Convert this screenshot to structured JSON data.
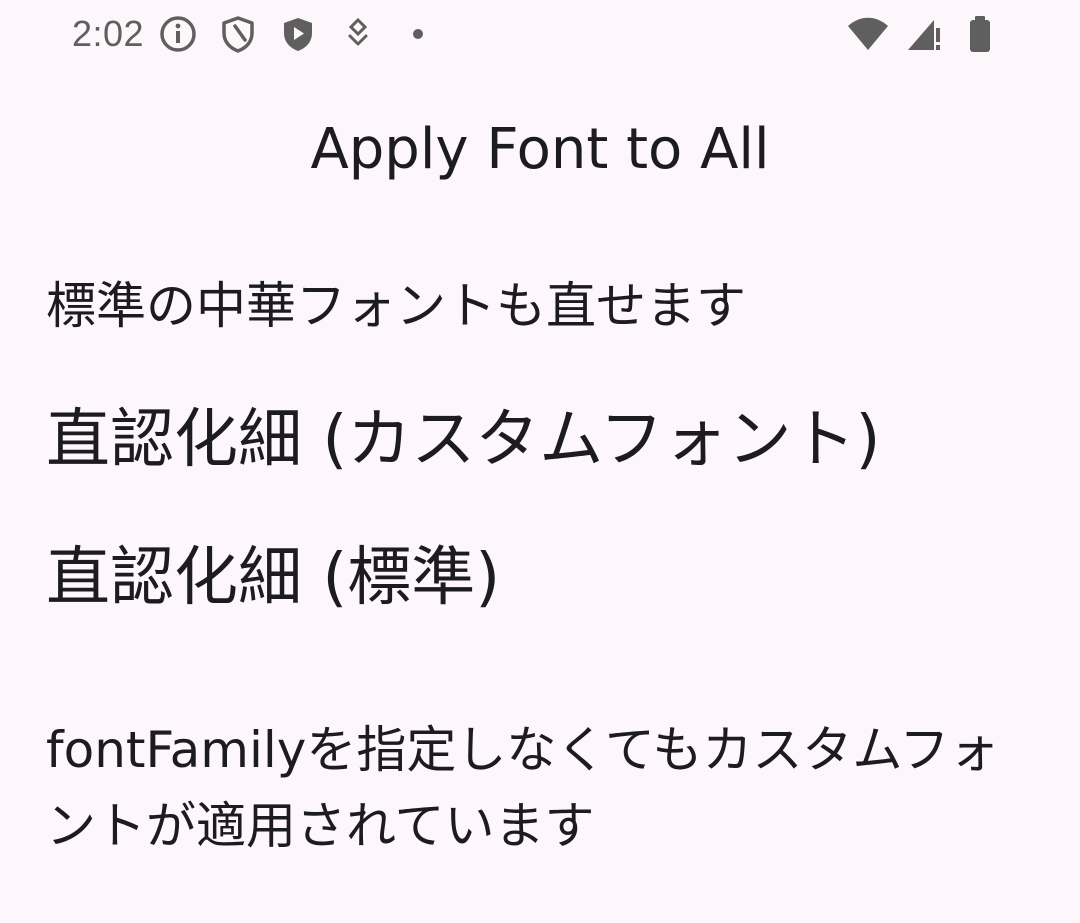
{
  "status_bar": {
    "time": "2:02",
    "left_icons": [
      "info-icon",
      "shield-outline-icon",
      "shield-play-icon",
      "location-pin-icon",
      "dot-icon"
    ],
    "right_icons": [
      "wifi-icon",
      "cellular-signal-icon",
      "battery-icon"
    ]
  },
  "app": {
    "title": "Apply Font to All"
  },
  "content": {
    "line1": "標準の中華フォントも直せます",
    "line2": "直認化細 (カスタムフォント)",
    "line3": "直認化細 (標準)",
    "line4": "fontFamilyを指定しなくてもカスタムフォントが適用されています"
  },
  "colors": {
    "background": "#fdf7fc",
    "text": "#1c1b1f",
    "status_icons": "#5f5f5f"
  }
}
